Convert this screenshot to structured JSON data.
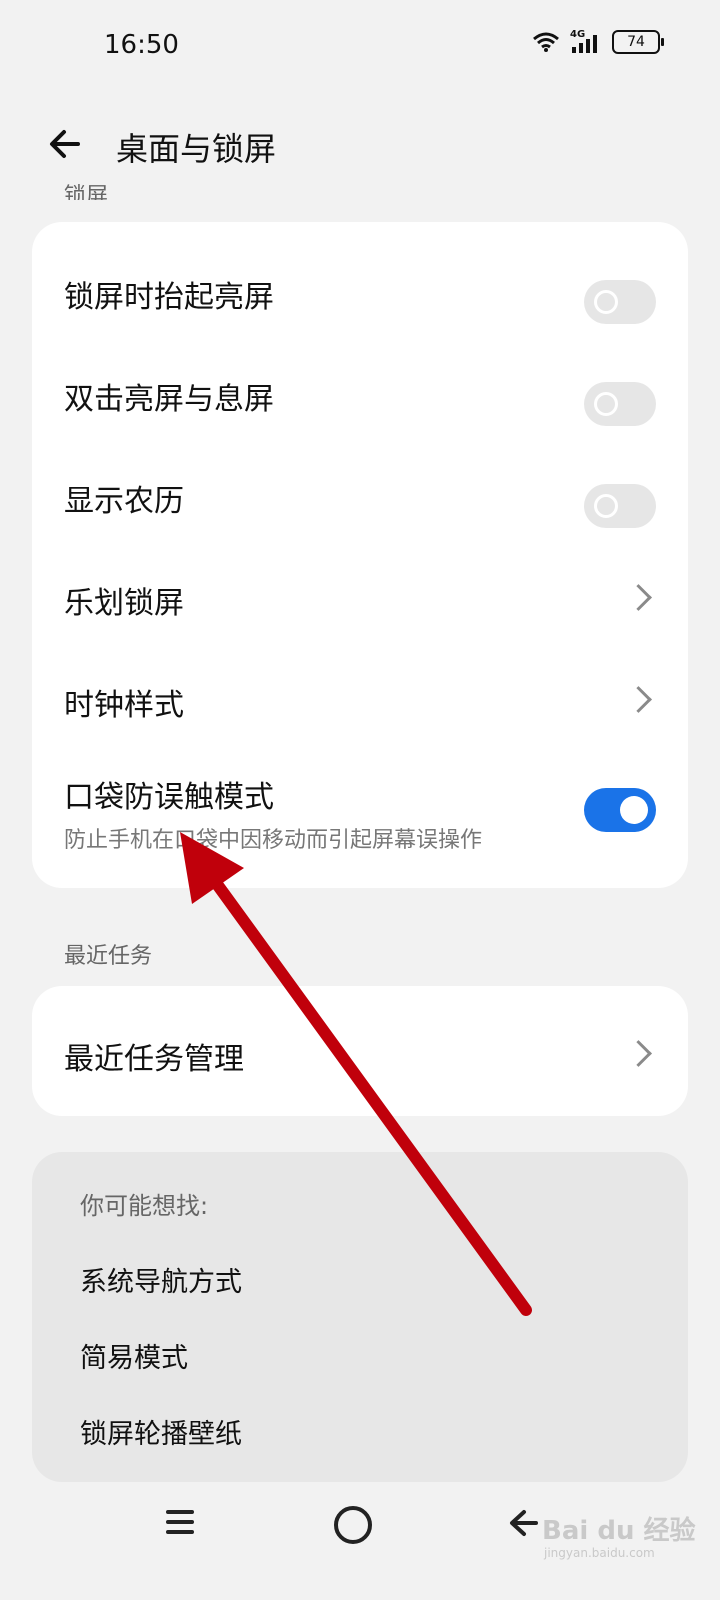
{
  "status": {
    "time": "16:50",
    "network": "4G",
    "battery": "74"
  },
  "header": {
    "title": "桌面与锁屏"
  },
  "sections": {
    "lock_partial": "锁屏",
    "recent_tasks": "最近任务"
  },
  "lock_settings": [
    {
      "label": "锁屏时抬起亮屏",
      "control": "toggle",
      "state": "off"
    },
    {
      "label": "双击亮屏与息屏",
      "control": "toggle",
      "state": "off"
    },
    {
      "label": "显示农历",
      "control": "toggle",
      "state": "off"
    },
    {
      "label": "乐划锁屏",
      "control": "chevron"
    },
    {
      "label": "时钟样式",
      "control": "chevron"
    },
    {
      "label": "口袋防误触模式",
      "subtitle": "防止手机在口袋中因移动而引起屏幕误操作",
      "control": "toggle",
      "state": "on"
    }
  ],
  "recent_tasks": [
    {
      "label": "最近任务管理",
      "control": "chevron"
    }
  ],
  "suggestions": {
    "title": "你可能想找:",
    "items": [
      "系统导航方式",
      "简易模式",
      "锁屏轮播壁纸"
    ]
  },
  "watermark": {
    "main": "Bai du 经验",
    "sub": "jingyan.baidu.com"
  },
  "colors": {
    "accent": "#1a73e8",
    "annotation_arrow": "#c0000b",
    "background": "#f2f2f2",
    "card": "#ffffff"
  },
  "icons": [
    "back-arrow-icon",
    "wifi-icon",
    "signal-icon",
    "battery-icon",
    "chevron-right-icon",
    "menu-icon",
    "home-icon",
    "back-icon"
  ]
}
